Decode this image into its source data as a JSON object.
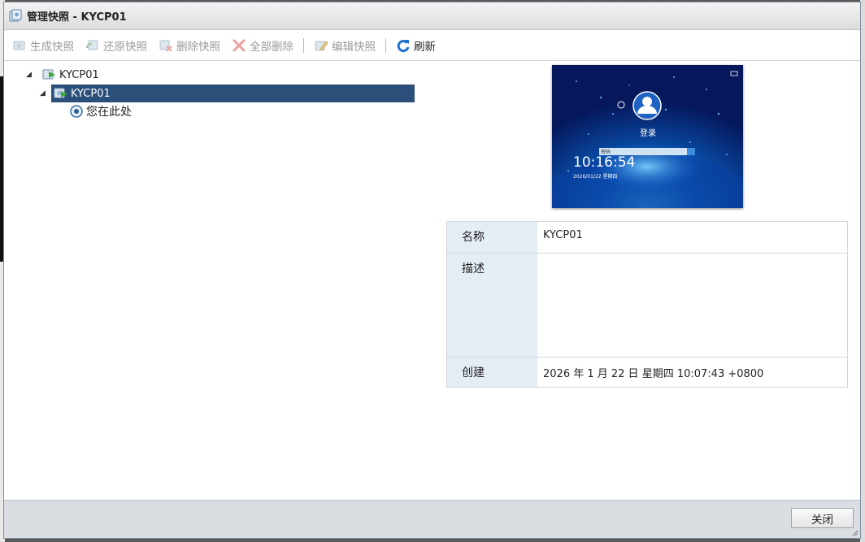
{
  "window": {
    "title": "管理快照 - KYCP01"
  },
  "toolbar": {
    "take_snapshot": "生成快照",
    "restore_snapshot": "还原快照",
    "delete_snapshot": "删除快照",
    "delete_all": "全部删除",
    "edit_snapshot": "编辑快照",
    "refresh": "刷新"
  },
  "tree": {
    "vm": "KYCP01",
    "snapshot": "KYCP01",
    "current": "您在此处"
  },
  "preview": {
    "time": "10:16:54",
    "date": "2026/01/22 星期四",
    "login": "登录",
    "field": "密码"
  },
  "details": {
    "name_label": "名称",
    "name_value": "KYCP01",
    "desc_label": "描述",
    "desc_value": "",
    "created_label": "创建",
    "created_value": "2026 年 1 月 22 日 星期四 10:07:43 +0800"
  },
  "footer": {
    "close": "关闭"
  },
  "colors": {
    "selection": "#2c4f7a",
    "label_bg": "#e4ecf4",
    "refresh_icon": "#1d6fd1",
    "delete_icon": "#e05a5a"
  }
}
